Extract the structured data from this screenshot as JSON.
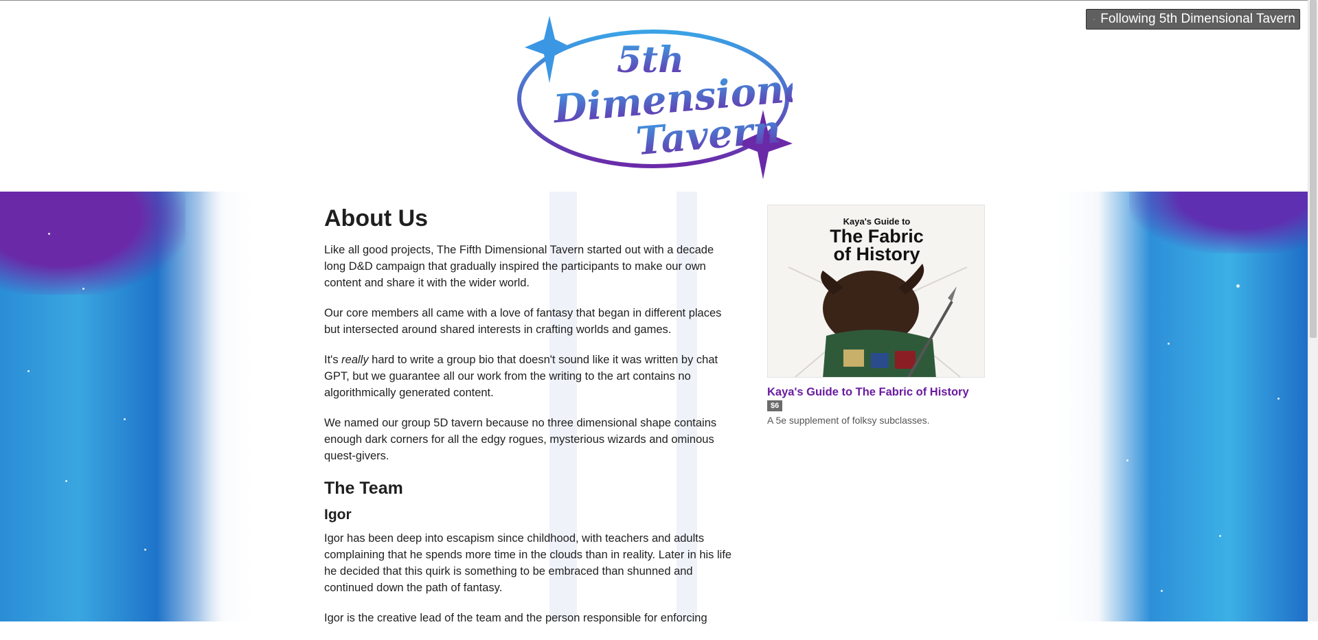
{
  "header": {
    "logo_lines": [
      "5th",
      "Dimensional",
      "Tavern"
    ],
    "follow_button_label": "Following 5th Dimensional Tavern"
  },
  "main": {
    "title": "About Us",
    "paragraphs": [
      "Like all good projects, The Fifth Dimensional Tavern started out with a decade long D&D campaign that gradually inspired the participants to make our own content and share it with the wider world.",
      "Our core members all came with a love of fantasy that began in different places but intersected around shared interests in crafting worlds and games."
    ],
    "para3_before": "It's ",
    "para3_emphasis": "really",
    "para3_after": " hard to write a group bio that doesn't sound like it was written by chat GPT, but we guarantee all our work from the writing to the art contains no algorithmically generated content.",
    "para4": "We named our group 5D tavern because no three dimensional shape contains enough dark corners for all the edgy rogues, mysterious wizards and ominous quest-givers.",
    "team_heading": "The Team",
    "member_name": "Igor",
    "member_bio": "Igor has been deep into escapism since childhood, with teachers and adults complaining that he spends more time in the clouds than in reality. Later in his life he decided that this quirk is something to be embraced than shunned and continued down the path of fantasy.",
    "member_bio_2": "Igor is the creative lead of the team and the person responsible for enforcing"
  },
  "product": {
    "cover_subtitle": "Kaya's Guide to",
    "cover_title_line1": "The Fabric",
    "cover_title_line2": "of History",
    "title": "Kaya's Guide to The Fabric of History",
    "price": "$6",
    "description": "A 5e supplement of folksy subclasses."
  },
  "colors": {
    "accent_purple": "#6a1aa0",
    "logo_blue": "#3aa3e6",
    "logo_purple": "#6a2aa8",
    "button_bg": "#5f5f5f"
  },
  "icons": {
    "follow_check": "check-icon",
    "logo_stars": "sparkle-star-icon"
  }
}
